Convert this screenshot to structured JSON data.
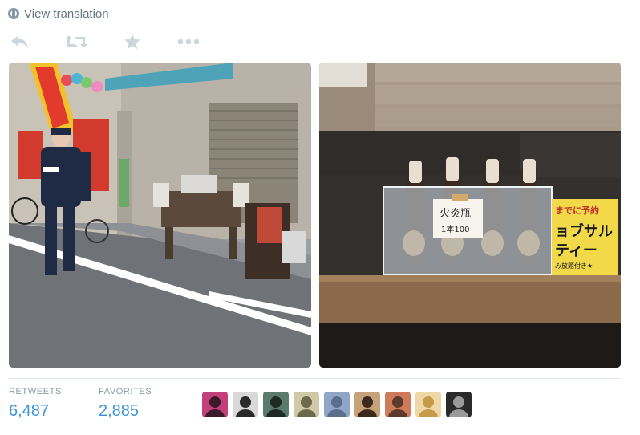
{
  "translation": {
    "label": "View translation"
  },
  "actions": [
    "reply-icon",
    "retweet-icon",
    "favorite-icon",
    "more-icon"
  ],
  "colors": {
    "icon": "#ccd6dd",
    "accent": "#3b94d9",
    "label": "#8899a6",
    "text": "#66757f"
  },
  "photo_right": {
    "sign_main": "火炎瓶",
    "sign_sub": "1本100",
    "poster_top": "までに予約",
    "poster_mid": "ョブサル",
    "poster_line3": "ティー",
    "poster_bottom": "み放題付き★"
  },
  "stats": {
    "retweets_label": "RETWEETS",
    "retweets_value": "6,487",
    "favorites_label": "FAVORITES",
    "favorites_value": "2,885"
  },
  "avatars": [
    {
      "name": "avatar-1",
      "bg": "#c43f7a",
      "fg": "#3a1a2b"
    },
    {
      "name": "avatar-2",
      "bg": "#d8d8d8",
      "fg": "#2a2a2a"
    },
    {
      "name": "avatar-3",
      "bg": "#5a7a6e",
      "fg": "#1d2a26"
    },
    {
      "name": "avatar-4",
      "bg": "#cfc9a8",
      "fg": "#6b6a4a"
    },
    {
      "name": "avatar-5",
      "bg": "#8fa6c9",
      "fg": "#5b6f8c"
    },
    {
      "name": "avatar-6",
      "bg": "#c6a27a",
      "fg": "#3b2a1d"
    },
    {
      "name": "avatar-7",
      "bg": "#d07a5c",
      "fg": "#5d3a2a"
    },
    {
      "name": "avatar-8",
      "bg": "#f0d7a8",
      "fg": "#c59a4a"
    },
    {
      "name": "avatar-9",
      "bg": "#2a2a2a",
      "fg": "#9a9a9a"
    }
  ]
}
